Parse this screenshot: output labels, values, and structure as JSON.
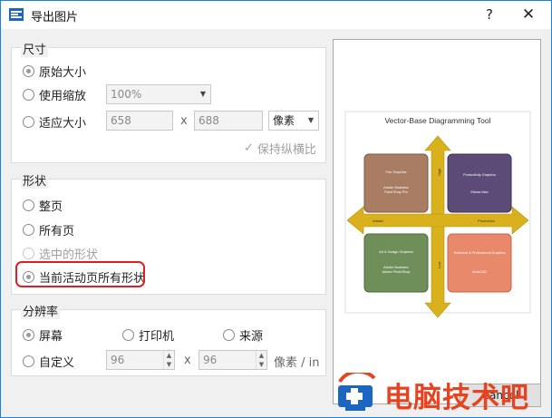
{
  "window": {
    "title": "导出图片",
    "help": "?",
    "close": "✕"
  },
  "size": {
    "title": "尺寸",
    "original": "原始大小",
    "zoom": "使用缩放",
    "zoom_value": "100%",
    "fit": "适应大小",
    "width": "658",
    "times": "x",
    "height": "688",
    "unit": "像素",
    "keep_ratio": "保持纵横比",
    "check": "✓"
  },
  "shape": {
    "title": "形状",
    "whole": "整页",
    "all_pages": "所有页",
    "selected": "选中的形状",
    "current_all": "当前活动页所有形状"
  },
  "resolution": {
    "title": "分辨率",
    "screen": "屏幕",
    "printer": "打印机",
    "source": "来源",
    "custom": "自定义",
    "x_value": "96",
    "times": "x",
    "y_value": "96",
    "unit": "像素 / in"
  },
  "preview": {
    "title": "Vector-Base Diagramming Tool",
    "quadrants": [
      {
        "title": "Fun Graphics",
        "line1": "Adobe Illustrator",
        "line2": "Paint Shop Pro",
        "color": "#a87d63"
      },
      {
        "title": "Productivity Graphics",
        "line1": "Edraw Max",
        "line2": "",
        "color": "#5d4b77"
      },
      {
        "title": "Art & Design Graphics",
        "line1": "Adobe Illustrator",
        "line2": "Adobe PhotoShop",
        "color": "#6f8f5a"
      },
      {
        "title": "Technical & Professional Graphics",
        "line1": "AutoCAD",
        "line2": "",
        "color": "#e9896b"
      }
    ],
    "labels": {
      "high": "High",
      "low": "Low",
      "artistic": "Artistic",
      "productive": "Productive"
    },
    "arrow_color": "#d9b11c"
  },
  "buttons": {
    "cancel_partial": "Cancel"
  },
  "watermark": {
    "text": "电脑技术吧"
  }
}
